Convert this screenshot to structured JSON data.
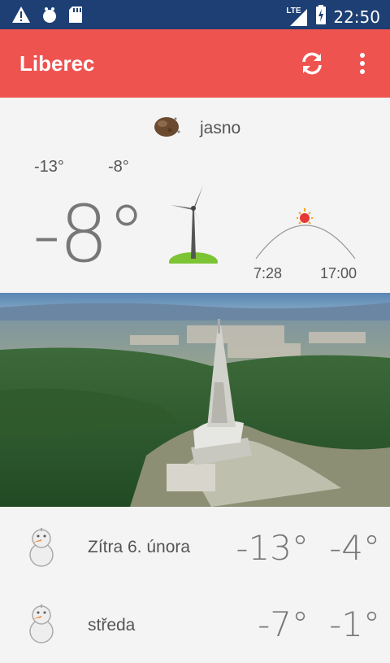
{
  "status_bar": {
    "network": "LTE",
    "time": "22:50",
    "icons": [
      "warning-icon",
      "bug-icon",
      "sd-card-icon",
      "signal-icon",
      "battery-charging-icon"
    ]
  },
  "app_bar": {
    "title": "Liberec",
    "icons": [
      "refresh-icon",
      "more-vert-icon"
    ],
    "color": "#ef5350"
  },
  "current": {
    "condition": "jasno",
    "temp_min": "-13°",
    "temp_max": "-8°",
    "temp_now": "-8°",
    "sunrise": "7:28",
    "sunset": "17:00",
    "icons": [
      "moon-icon",
      "wind-turbine-icon",
      "sun-arc-icon"
    ]
  },
  "photo": {
    "subject": "jested-tower-icon"
  },
  "forecast": [
    {
      "day": "Zítra 6. února",
      "low": "-13°",
      "high": "-4°",
      "icon": "snowman-icon"
    },
    {
      "day": "středa",
      "low": "-7°",
      "high": "-1°",
      "icon": "snowman-icon"
    }
  ]
}
